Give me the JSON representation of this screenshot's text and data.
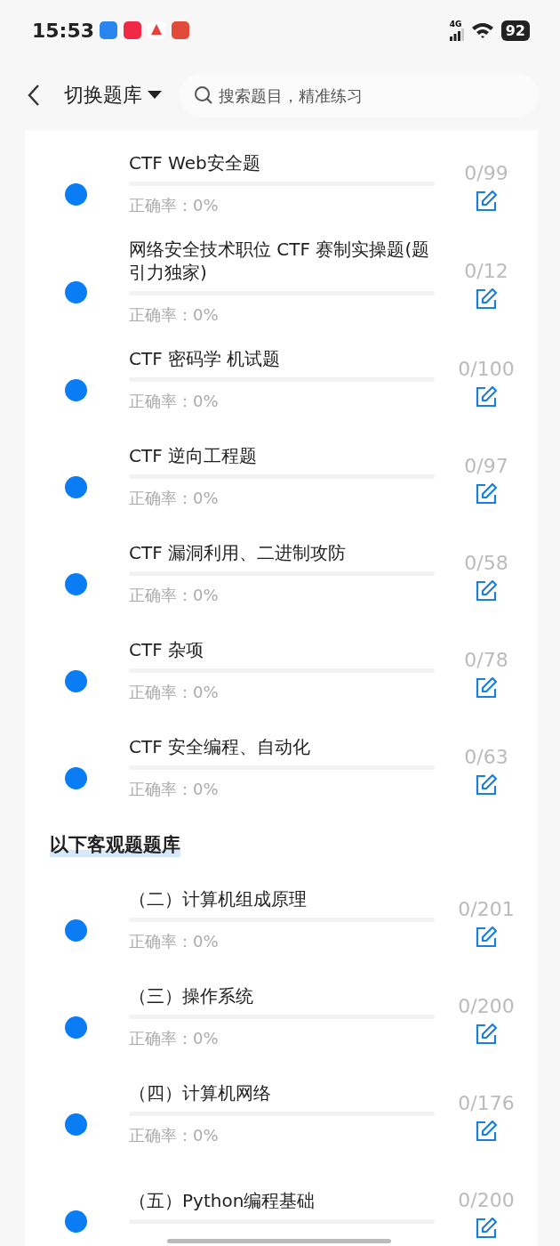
{
  "status_bar": {
    "time": "15:53",
    "network": "4G",
    "battery": "92"
  },
  "header": {
    "title": "切换题库",
    "search": {
      "placeholder": "搜索题目，精准练习"
    }
  },
  "sections": [
    {
      "items": [
        {
          "title": "CTF Web安全题",
          "level": 0,
          "accuracy": "正确率：0%",
          "count": "0/99"
        },
        {
          "title": "网络安全技术职位 CTF 赛制实操题(题引力独家)",
          "level": 0,
          "accuracy": "正确率：0%",
          "count": "0/12"
        },
        {
          "title": "CTF 密码学 机试题",
          "level": 0,
          "accuracy": "正确率：0%",
          "count": "0/100"
        },
        {
          "title": "CTF 逆向工程题",
          "level": 0,
          "accuracy": "正确率：0%",
          "count": "0/97"
        },
        {
          "title": "CTF 漏洞利用、二进制攻防",
          "level": 0,
          "accuracy": "正确率：0%",
          "count": "0/58"
        },
        {
          "title": "CTF 杂项",
          "level": 0,
          "accuracy": "正确率：0%",
          "count": "0/78"
        },
        {
          "title": "CTF 安全编程、自动化",
          "level": 0,
          "accuracy": "正确率：0%",
          "count": "0/63"
        }
      ]
    },
    {
      "heading": "以下客观题题库",
      "items": [
        {
          "title": "（二）计算机组成原理",
          "level": 0,
          "accuracy": "正确率：0%",
          "count": "0/201"
        },
        {
          "title": "（三）操作系统",
          "level": 0,
          "accuracy": "正确率：0%",
          "count": "0/200"
        },
        {
          "title": "（四）计算机网络",
          "level": 0,
          "accuracy": "正确率：0%",
          "count": "0/176"
        },
        {
          "title": "（五）Python编程基础",
          "level": 0,
          "count": "0/200"
        }
      ]
    }
  ]
}
